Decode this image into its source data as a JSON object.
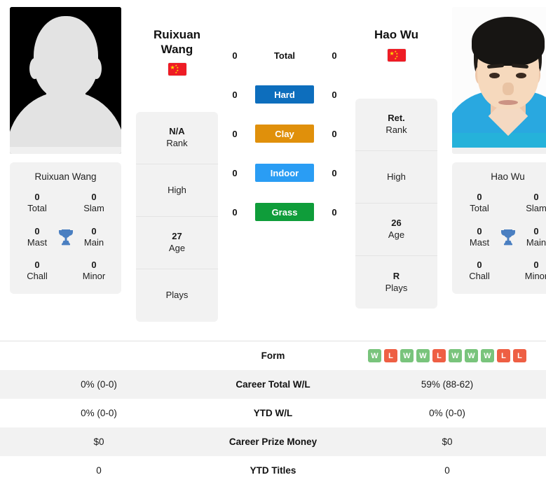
{
  "players": {
    "left": {
      "name": "Ruixuan Wang",
      "name_line1": "Ruixuan",
      "name_line2": "Wang",
      "country_flag": "cn-flag-icon",
      "photo": "silhouette-placeholder",
      "titles": {
        "total_value": "0",
        "total_label": "Total",
        "slam_value": "0",
        "slam_label": "Slam",
        "mast_value": "0",
        "mast_label": "Mast",
        "main_value": "0",
        "main_label": "Main",
        "chall_value": "0",
        "chall_label": "Chall",
        "minor_value": "0",
        "minor_label": "Minor"
      },
      "info": [
        {
          "value": "N/A",
          "label": "Rank"
        },
        {
          "value": "",
          "label": "High"
        },
        {
          "value": "27",
          "label": "Age"
        },
        {
          "value": "",
          "label": "Plays"
        }
      ]
    },
    "right": {
      "name": "Hao Wu",
      "name_line1": "Hao Wu",
      "name_line2": "",
      "country_flag": "cn-flag-icon",
      "photo": "player-portrait",
      "titles": {
        "total_value": "0",
        "total_label": "Total",
        "slam_value": "0",
        "slam_label": "Slam",
        "mast_value": "0",
        "mast_label": "Mast",
        "main_value": "0",
        "main_label": "Main",
        "chall_value": "0",
        "chall_label": "Chall",
        "minor_value": "0",
        "minor_label": "Minor"
      },
      "info": [
        {
          "value": "Ret.",
          "label": "Rank"
        },
        {
          "value": "",
          "label": "High"
        },
        {
          "value": "26",
          "label": "Age"
        },
        {
          "value": "R",
          "label": "Plays"
        }
      ]
    }
  },
  "surfaces": [
    {
      "label": "Total",
      "left": "0",
      "right": "0",
      "color": "transparent",
      "text_color": "#111111",
      "plain": true
    },
    {
      "label": "Hard",
      "left": "0",
      "right": "0",
      "color": "#0d6ebd",
      "text_color": "#ffffff",
      "plain": false
    },
    {
      "label": "Clay",
      "left": "0",
      "right": "0",
      "color": "#e0900b",
      "text_color": "#ffffff",
      "plain": false
    },
    {
      "label": "Indoor",
      "left": "0",
      "right": "0",
      "color": "#2a9df4",
      "text_color": "#ffffff",
      "plain": false
    },
    {
      "label": "Grass",
      "left": "0",
      "right": "0",
      "color": "#0f9d3a",
      "text_color": "#ffffff",
      "plain": false
    }
  ],
  "comparison_table": [
    {
      "label": "Form",
      "left": "",
      "right": "",
      "left_form": [],
      "right_form": [
        "W",
        "L",
        "W",
        "W",
        "L",
        "W",
        "W",
        "W",
        "L",
        "L"
      ],
      "striped": false
    },
    {
      "label": "Career Total W/L",
      "left": "0% (0-0)",
      "right": "59% (88-62)",
      "left_form": [],
      "right_form": [],
      "striped": true
    },
    {
      "label": "YTD W/L",
      "left": "0% (0-0)",
      "right": "0% (0-0)",
      "left_form": [],
      "right_form": [],
      "striped": false
    },
    {
      "label": "Career Prize Money",
      "left": "$0",
      "right": "$0",
      "left_form": [],
      "right_form": [],
      "striped": true
    },
    {
      "label": "YTD Titles",
      "left": "0",
      "right": "0",
      "left_form": [],
      "right_form": [],
      "striped": false
    }
  ],
  "colors": {
    "card_bg": "#f2f2f2",
    "win_badge": "#79c47c",
    "loss_badge": "#ee5f44",
    "trophy": "#4a7fc1"
  }
}
